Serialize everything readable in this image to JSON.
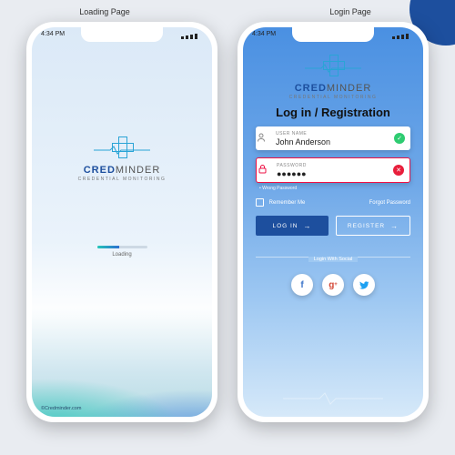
{
  "page_labels": {
    "loading": "Loading Page",
    "login": "Login Page"
  },
  "status": {
    "time": "4:34 PM"
  },
  "brand": {
    "name_a": "CRED",
    "name_b": "MINDER",
    "tagline": "CREDENTIAL MONITORING",
    "copyright": "©Credminder.com"
  },
  "loading": {
    "label": "Loading",
    "progress_pct": 45
  },
  "login": {
    "title": "Log in / Registration",
    "username": {
      "label": "USER NAME",
      "value": "John Anderson",
      "valid": true
    },
    "password": {
      "label": "PASSWORD",
      "value": "●●●●●●",
      "valid": false,
      "error": "• Wrong Password"
    },
    "remember_label": "Remember Me",
    "forgot_label": "Forgot Password",
    "login_btn": "LOG IN",
    "register_btn": "REGISTER",
    "social_label": "Login With Social",
    "social": {
      "fb": "f",
      "google": "g",
      "twitter": "t"
    }
  },
  "icons": {
    "check": "✓",
    "close": "✕",
    "arrow": "→",
    "user": "◡",
    "lock": "🔒"
  }
}
